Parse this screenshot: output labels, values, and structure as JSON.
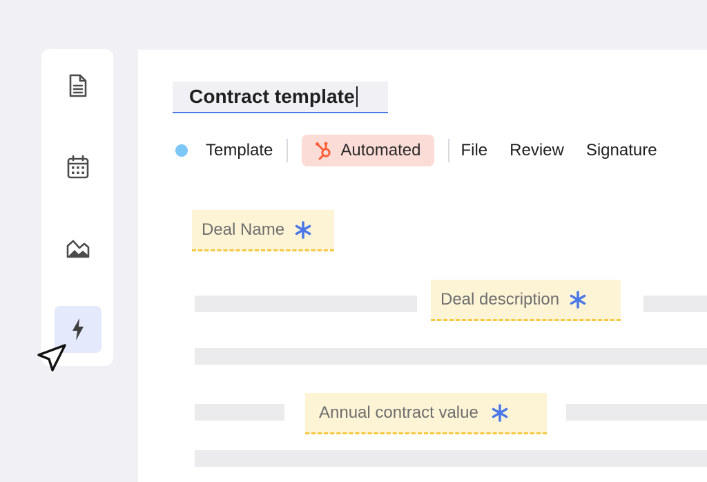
{
  "document": {
    "title": "Contract template"
  },
  "tabs": {
    "template": "Template",
    "automated": "Automated",
    "file": "File",
    "review": "Review",
    "signature": "Signature"
  },
  "fields": {
    "deal_name": "Deal Name",
    "deal_description": "Deal description",
    "annual_contract_value": "Annual contract value"
  },
  "sidebar": {
    "items": [
      {
        "icon": "document-icon",
        "active": false
      },
      {
        "icon": "calendar-icon",
        "active": false
      },
      {
        "icon": "image-icon",
        "active": false
      },
      {
        "icon": "lightning-icon",
        "active": true
      }
    ]
  },
  "colors": {
    "accent_blue": "#4a78e8",
    "status_dot": "#7cc7f5",
    "automated_pill": "#fcdcd6",
    "hubspot_orange": "#ff5c35",
    "field_bg": "#fdf4d6",
    "field_underline": "#f5c842",
    "sidebar_active": "#e4e9fb"
  }
}
